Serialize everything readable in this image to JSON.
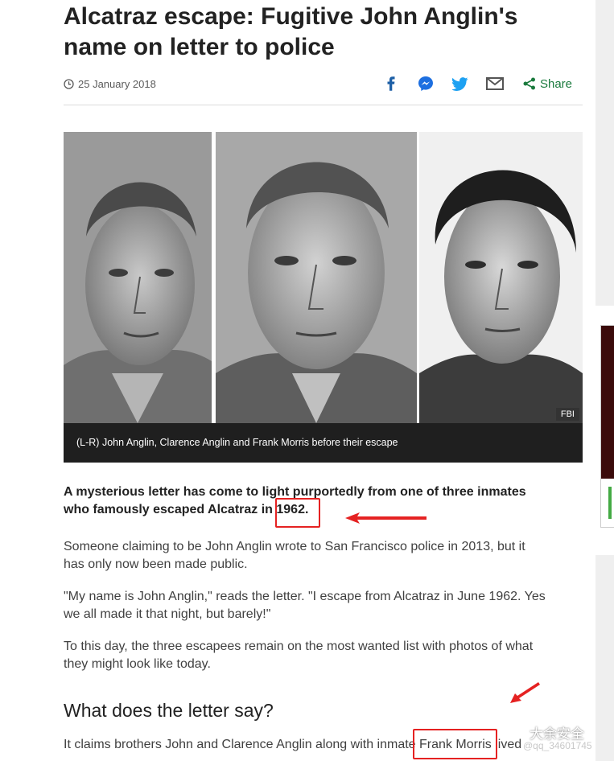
{
  "article": {
    "headline": "Alcatraz escape: Fugitive John Anglin's name on letter to police",
    "date": "25 January 2018",
    "share_label": "Share",
    "image_credit": "FBI",
    "caption": "(L-R) John Anglin, Clarence Anglin and Frank Morris before their escape",
    "lead": "A mysterious letter has come to light purportedly from one of three inmates who famously escaped Alcatraz in 1962.",
    "paragraphs": [
      "Someone claiming to be John Anglin wrote to San Francisco police in 2013, but it has only now been made public.",
      "\"My name is John Anglin,\" reads the letter. \"I escape from Alcatraz in June 1962. Yes we all made it that night, but barely!\"",
      "To this day, the three escapees remain on the most wanted list with photos of what they might look like today."
    ],
    "subheading": "What does the letter say?",
    "cut_paragraph": "It claims brothers John and Clarence Anglin along with inmate Frank Morris lived"
  },
  "share_icons": [
    "facebook-icon",
    "messenger-icon",
    "twitter-icon",
    "email-icon",
    "share-icon"
  ],
  "watermark": {
    "brand": "大余安全",
    "handle": "@qq_34601745"
  },
  "colors": {
    "headline": "#222222",
    "share_green": "#1a7a3d",
    "facebook": "#1d5fa6",
    "twitter": "#1da1f2",
    "annotation_red": "#e52222"
  }
}
